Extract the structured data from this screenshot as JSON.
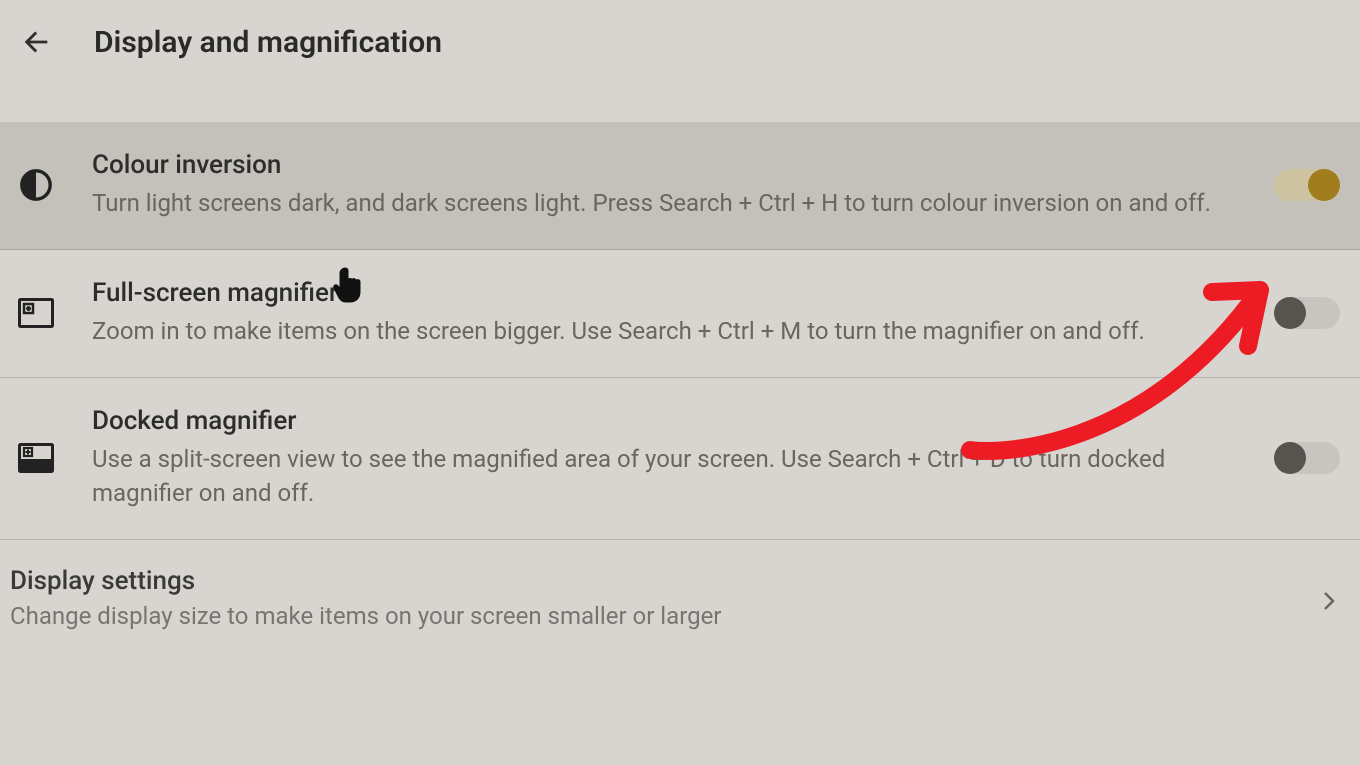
{
  "header": {
    "title": "Display and magnification"
  },
  "items": [
    {
      "id": "colour-inversion",
      "title": "Colour inversion",
      "description": "Turn light screens dark, and dark screens light. Press Search + Ctrl + H to turn colour inversion on and off.",
      "toggle": "on",
      "hovered": true
    },
    {
      "id": "fullscreen-magnifier",
      "title": "Full-screen magnifier",
      "description": "Zoom in to make items on the screen bigger. Use Search + Ctrl + M to turn the magnifier on and off.",
      "toggle": "off",
      "hovered": false
    },
    {
      "id": "docked-magnifier",
      "title": "Docked magnifier",
      "description": "Use a split-screen view to see the magnified area of your screen. Use Search + Ctrl + D to turn docked magnifier on and off.",
      "toggle": "off",
      "hovered": false
    }
  ],
  "link": {
    "title": "Display settings",
    "description": "Change display size to make items on your screen smaller or larger"
  },
  "annotation": {
    "arrow_color": "#ed1c24"
  }
}
